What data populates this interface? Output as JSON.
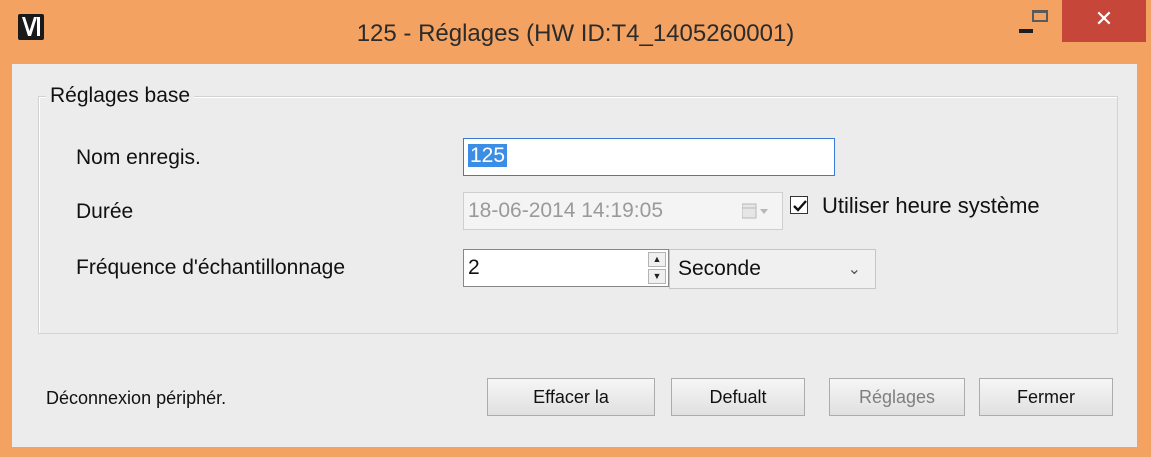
{
  "window": {
    "title": "125 - Réglages (HW ID:T4_1405260001)",
    "frame_color": "#f3a261",
    "close_color": "#c7463a",
    "close_glyph": "✕",
    "min_glyph": "",
    "max_glyph": ""
  },
  "group": {
    "legend": "Réglages base"
  },
  "fields": {
    "name_label": "Nom enregis.",
    "name_value": "125",
    "duration_label": "Durée",
    "duration_value": "18-06-2014 14:19:05",
    "use_system_time_label": "Utiliser heure système",
    "use_system_time_checked": true,
    "frequency_label": "Fréquence d'échantillonnage",
    "frequency_value": "2",
    "frequency_unit": "Seconde"
  },
  "footer": {
    "status": "Déconnexion périphér.",
    "buttons": {
      "clear": "Effacer la",
      "default": "Defualt",
      "settings": "Réglages",
      "close": "Fermer"
    }
  }
}
